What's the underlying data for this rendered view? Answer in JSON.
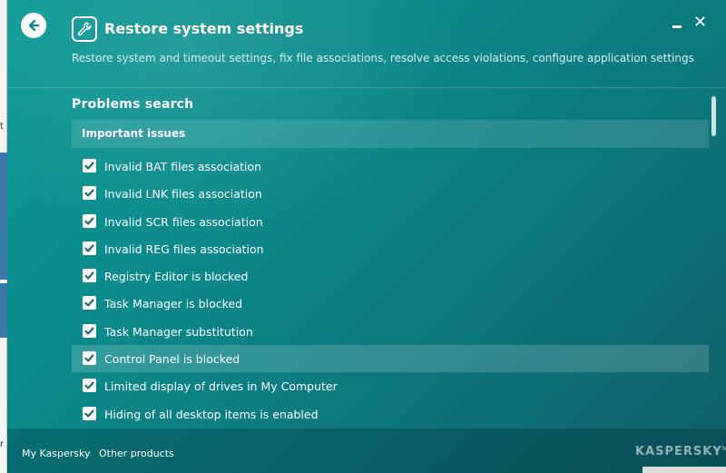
{
  "window": {
    "title": "Restore system settings",
    "subtitle": "Restore system and timeout settings, fix file associations, resolve access violations, configure application settings",
    "minimize_icon": "minimize-icon",
    "close_label": "✕"
  },
  "background_glyphs": [
    "t",
    "r"
  ],
  "section": {
    "title": "Problems search",
    "group_header": "Important issues"
  },
  "items": [
    {
      "label": "Invalid BAT files association",
      "checked": true
    },
    {
      "label": "Invalid LNK files association",
      "checked": true
    },
    {
      "label": "Invalid SCR files association",
      "checked": true
    },
    {
      "label": "Invalid REG files association",
      "checked": true
    },
    {
      "label": "Registry Editor is blocked",
      "checked": true
    },
    {
      "label": "Task Manager is blocked",
      "checked": true
    },
    {
      "label": "Task Manager substitution",
      "checked": true
    },
    {
      "label": "Control Panel is blocked",
      "checked": true,
      "selected": true
    },
    {
      "label": "Limited display of drives in My Computer",
      "checked": true
    },
    {
      "label": "Hiding of all desktop items is enabled",
      "checked": true
    }
  ],
  "footer": {
    "my_kaspersky": "My Kaspersky",
    "other_products": "Other products",
    "brand": "KASPERSKY",
    "brand_mark": "lab"
  },
  "colors": {
    "accent": "#0c8a8b",
    "check": "#1c6f77"
  }
}
